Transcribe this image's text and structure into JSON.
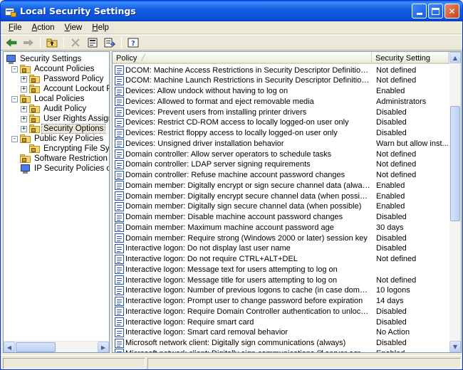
{
  "window": {
    "title": "Local Security Settings"
  },
  "menu": [
    "File",
    "Action",
    "View",
    "Help"
  ],
  "toolbar": {
    "buttons": [
      "back-arrow-icon",
      "forward-arrow-icon",
      "up-folder-icon",
      "delete-icon",
      "properties-icon",
      "export-list-icon",
      "help-icon"
    ]
  },
  "tree": [
    {
      "label": "Security Settings",
      "level": 0,
      "expander": "-",
      "icon": "monitor"
    },
    {
      "label": "Account Policies",
      "level": 1,
      "expander": "-",
      "icon": "folder"
    },
    {
      "label": "Password Policy",
      "level": 2,
      "expander": "+",
      "icon": "folder"
    },
    {
      "label": "Account Lockout Policy",
      "level": 2,
      "expander": "+",
      "icon": "folder"
    },
    {
      "label": "Local Policies",
      "level": 1,
      "expander": "-",
      "icon": "folder"
    },
    {
      "label": "Audit Policy",
      "level": 2,
      "expander": "+",
      "icon": "folder"
    },
    {
      "label": "User Rights Assignment",
      "level": 2,
      "expander": "+",
      "icon": "folder"
    },
    {
      "label": "Security Options",
      "level": 2,
      "expander": "+",
      "icon": "folder",
      "selected": true
    },
    {
      "label": "Public Key Policies",
      "level": 1,
      "expander": "-",
      "icon": "folder"
    },
    {
      "label": "Encrypting File System",
      "level": 2,
      "expander": "",
      "icon": "folder"
    },
    {
      "label": "Software Restriction Policies",
      "level": 1,
      "expander": "",
      "icon": "folder"
    },
    {
      "label": "IP Security Policies on Local Computer",
      "level": 1,
      "expander": "",
      "icon": "monitor"
    }
  ],
  "list": {
    "columns": {
      "policy": "Policy",
      "setting": "Security Setting"
    },
    "rows": [
      {
        "policy": "DCOM: Machine Access Restrictions in Security Descriptor Definition Language (...",
        "setting": "Not defined"
      },
      {
        "policy": "DCOM: Machine Launch Restrictions in Security Descriptor Definition Language (...",
        "setting": "Not defined"
      },
      {
        "policy": "Devices: Allow undock without having to log on",
        "setting": "Enabled"
      },
      {
        "policy": "Devices: Allowed to format and eject removable media",
        "setting": "Administrators"
      },
      {
        "policy": "Devices: Prevent users from installing printer drivers",
        "setting": "Disabled"
      },
      {
        "policy": "Devices: Restrict CD-ROM access to locally logged-on user only",
        "setting": "Disabled"
      },
      {
        "policy": "Devices: Restrict floppy access to locally logged-on user only",
        "setting": "Disabled"
      },
      {
        "policy": "Devices: Unsigned driver installation behavior",
        "setting": "Warn but allow inst..."
      },
      {
        "policy": "Domain controller: Allow server operators to schedule tasks",
        "setting": "Not defined"
      },
      {
        "policy": "Domain controller: LDAP server signing requirements",
        "setting": "Not defined"
      },
      {
        "policy": "Domain controller: Refuse machine account password changes",
        "setting": "Not defined"
      },
      {
        "policy": "Domain member: Digitally encrypt or sign secure channel data (always)",
        "setting": "Enabled"
      },
      {
        "policy": "Domain member: Digitally encrypt secure channel data (when possible)",
        "setting": "Enabled"
      },
      {
        "policy": "Domain member: Digitally sign secure channel data (when possible)",
        "setting": "Enabled"
      },
      {
        "policy": "Domain member: Disable machine account password changes",
        "setting": "Disabled"
      },
      {
        "policy": "Domain member: Maximum machine account password age",
        "setting": "30 days"
      },
      {
        "policy": "Domain member: Require strong (Windows 2000 or later) session key",
        "setting": "Disabled"
      },
      {
        "policy": "Interactive logon: Do not display last user name",
        "setting": "Disabled"
      },
      {
        "policy": "Interactive logon: Do not require CTRL+ALT+DEL",
        "setting": "Not defined"
      },
      {
        "policy": "Interactive logon: Message text for users attempting to log on",
        "setting": ""
      },
      {
        "policy": "Interactive logon: Message title for users attempting to log on",
        "setting": "Not defined"
      },
      {
        "policy": "Interactive logon: Number of previous logons to cache (in case domain controller...",
        "setting": "10 logons"
      },
      {
        "policy": "Interactive logon: Prompt user to change password before expiration",
        "setting": "14 days"
      },
      {
        "policy": "Interactive logon: Require Domain Controller authentication to unlock workstation",
        "setting": "Disabled"
      },
      {
        "policy": "Interactive logon: Require smart card",
        "setting": "Disabled"
      },
      {
        "policy": "Interactive logon: Smart card removal behavior",
        "setting": "No Action"
      },
      {
        "policy": "Microsoft network client: Digitally sign communications (always)",
        "setting": "Disabled"
      },
      {
        "policy": "Microsoft network client: Digitally sign communications (if server agrees)",
        "setting": "Enabled"
      }
    ]
  }
}
